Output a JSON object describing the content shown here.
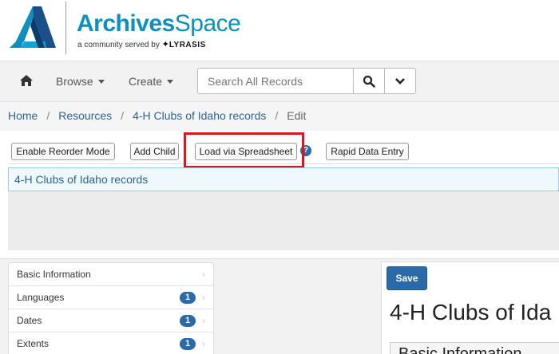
{
  "brand": {
    "name_part1": "Archives",
    "name_part2": "Space",
    "tagline": "a community served by",
    "partner_star": "✦",
    "partner": "LYRASIS"
  },
  "navbar": {
    "home_icon": "home-icon",
    "browse_label": "Browse",
    "create_label": "Create",
    "search_placeholder": "Search All Records",
    "search_icon": "search-icon",
    "expand_icon": "chevron-down-icon"
  },
  "breadcrumb": {
    "items": [
      "Home",
      "Resources",
      "4-H Clubs of Idaho records"
    ],
    "separator": "/",
    "current": "Edit"
  },
  "tree_toolbar": {
    "reorder_label": "Enable Reorder Mode",
    "add_child_label": "Add Child",
    "load_spreadsheet_label": "Load via Spreadsheet",
    "help_label": "?",
    "rapid_entry_label": "Rapid Data Entry"
  },
  "tree": {
    "root_label": "4-H Clubs of Idaho records"
  },
  "sidenav": {
    "items": [
      {
        "label": "Basic Information",
        "count": null
      },
      {
        "label": "Languages",
        "count": "1"
      },
      {
        "label": "Dates",
        "count": "1"
      },
      {
        "label": "Extents",
        "count": "1"
      }
    ],
    "chevron": "›"
  },
  "form": {
    "save_label": "Save",
    "title": "4-H Clubs of Ida",
    "section_heading": "Basic Information"
  },
  "colors": {
    "brand_blue": "#0c8fc1",
    "primary_button": "#2b6aa8",
    "highlight_red": "#e0141e",
    "link": "#2a6496"
  }
}
